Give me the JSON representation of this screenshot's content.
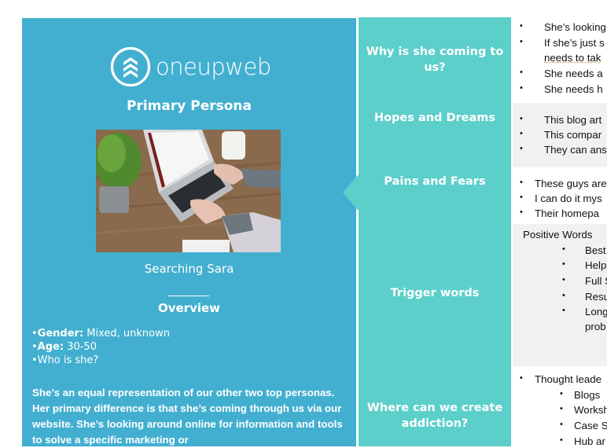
{
  "brand": {
    "name": "oneupweb",
    "logo_icon": "stacked-chevrons-up-icon",
    "panel_color": "#43afd0",
    "label_color": "#5ccfca"
  },
  "persona": {
    "title": "Primary Persona",
    "photo_alt": "Woman typing on a laptop showing Google search, plant and coffee cup on wooden desk",
    "name": "Searching Sara",
    "overview_heading": "Overview",
    "facts": [
      {
        "label": "Gender:",
        "value": " Mixed, unknown"
      },
      {
        "label": "Age:",
        "value": " 30-50"
      },
      {
        "label": "",
        "value": "Who is she?"
      }
    ],
    "bullet": "•",
    "description": "She’s an equal representation of our other two top personas. Her primary difference is that she’s coming through us via our website. She’s looking around online for information and tools to solve a specific marketing or"
  },
  "sections": [
    {
      "label": "Why is she coming to us?",
      "items": [
        "She’s looking",
        "If she’s just s",
        "needs to tak",
        "She needs a",
        "She needs h"
      ]
    },
    {
      "label": "Hopes and Dreams",
      "items": [
        "This blog art",
        "This compar",
        "They can ans"
      ]
    },
    {
      "label": "Pains and Fears",
      "items": [
        "These guys are",
        "I can do it mys",
        "Their homepa"
      ]
    },
    {
      "label": "Trigger words",
      "heading": "Positive Words",
      "items": [
        "Best",
        "Help",
        "Full S",
        "Resu",
        "Long",
        "prob"
      ]
    },
    {
      "label": "Where can we create addiction?",
      "items": [
        "Thought leade",
        "Blogs",
        "Worksh",
        "Case St",
        "Hub ar"
      ]
    }
  ]
}
